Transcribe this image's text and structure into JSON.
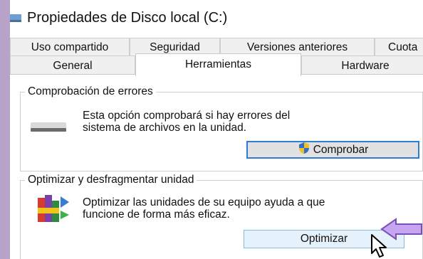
{
  "window": {
    "title": "Propiedades de Disco local (C:)"
  },
  "tabs": {
    "row1": [
      "Uso compartido",
      "Seguridad",
      "Versiones anteriores",
      "Cuota"
    ],
    "row2": [
      "General",
      "Herramientas",
      "Hardware"
    ],
    "active": "Herramientas"
  },
  "error_check": {
    "heading": "Comprobación de errores",
    "line1": "Esta opción comprobará si hay errores del",
    "line2": "sistema de archivos en la unidad.",
    "button_label": "Comprobar",
    "icon": "drive-icon"
  },
  "optimize": {
    "heading": "Optimizar y desfragmentar unidad",
    "line1": "Optimizar las unidades de su equipo ayuda a que",
    "line2": "funcione de forma más eficaz.",
    "button_label": "Optimizar",
    "icon": "defrag-icon"
  },
  "colors": {
    "accent": "#2f7bd6",
    "background": "#b7a2c8",
    "arrow": "#c6a6f0"
  }
}
